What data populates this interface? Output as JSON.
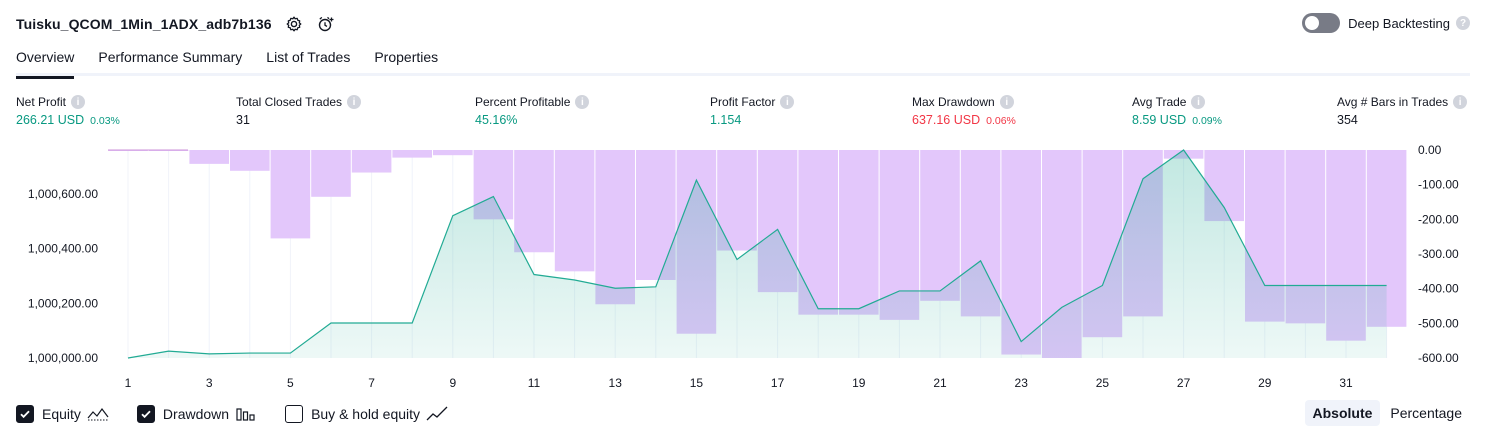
{
  "header": {
    "strategy_name": "Tuisku_QCOM_1Min_1ADX_adb7b136",
    "deep_backtesting_label": "Deep Backtesting",
    "deep_backtesting_on": false
  },
  "tabs": [
    {
      "label": "Overview",
      "active": true
    },
    {
      "label": "Performance Summary",
      "active": false
    },
    {
      "label": "List of Trades",
      "active": false
    },
    {
      "label": "Properties",
      "active": false
    }
  ],
  "stats": [
    {
      "label": "Net Profit",
      "value": "266.21 USD",
      "sub": "0.03%",
      "tone": "pos"
    },
    {
      "label": "Total Closed Trades",
      "value": "31",
      "sub": "",
      "tone": "neutral"
    },
    {
      "label": "Percent Profitable",
      "value": "45.16%",
      "sub": "",
      "tone": "pos"
    },
    {
      "label": "Profit Factor",
      "value": "1.154",
      "sub": "",
      "tone": "pos"
    },
    {
      "label": "Max Drawdown",
      "value": "637.16 USD",
      "sub": "0.06%",
      "tone": "neg"
    },
    {
      "label": "Avg Trade",
      "value": "8.59 USD",
      "sub": "0.09%",
      "tone": "pos"
    },
    {
      "label": "Avg # Bars in Trades",
      "value": "354",
      "sub": "",
      "tone": "neutral"
    }
  ],
  "chart_data": {
    "type": "line",
    "x": [
      1,
      2,
      3,
      4,
      5,
      6,
      7,
      8,
      9,
      10,
      11,
      12,
      13,
      14,
      15,
      16,
      17,
      18,
      19,
      20,
      21,
      22,
      23,
      24,
      25,
      26,
      27,
      28,
      29,
      30,
      31,
      32
    ],
    "x_ticks": [
      1,
      3,
      5,
      7,
      9,
      11,
      13,
      15,
      17,
      19,
      21,
      23,
      25,
      27,
      29,
      31
    ],
    "series": [
      {
        "name": "Equity",
        "axis": "left",
        "style": "area",
        "color": "#22ab94",
        "values": [
          1000000,
          1000025,
          1000015,
          1000018,
          1000018,
          1000128,
          1000128,
          1000128,
          1000520,
          1000590,
          1000305,
          1000285,
          1000255,
          1000260,
          1000650,
          1000360,
          1000470,
          1000180,
          1000180,
          1000245,
          1000245,
          1000355,
          1000060,
          1000185,
          1000265,
          1000655,
          1000760,
          1000550,
          1000265,
          1000265,
          1000265,
          1000265
        ]
      },
      {
        "name": "Drawdown",
        "axis": "right",
        "style": "bar",
        "color": "#ce93d8",
        "values": [
          -2,
          -2,
          -40,
          -60,
          -255,
          -135,
          -65,
          -22,
          -15,
          -200,
          -295,
          -350,
          -445,
          -375,
          -530,
          -290,
          -410,
          -475,
          -475,
          -490,
          -435,
          -480,
          -590,
          -600,
          -540,
          -480,
          -25,
          -205,
          -495,
          -500,
          -550,
          -510
        ]
      }
    ],
    "left_axis": {
      "ticks": [
        1000000,
        1000200,
        1000400,
        1000600
      ],
      "tick_labels": [
        "1,000,000.00",
        "1,000,200.00",
        "1,000,400.00",
        "1,000,600.00"
      ],
      "ylim": [
        1000000,
        1000760
      ]
    },
    "right_axis": {
      "ticks": [
        0,
        -100,
        -200,
        -300,
        -400,
        -500,
        -600
      ],
      "tick_labels": [
        "0.00",
        "-100.00",
        "-200.00",
        "-300.00",
        "-400.00",
        "-500.00",
        "-600.00"
      ],
      "ylim": [
        -600,
        0
      ]
    },
    "grid": true
  },
  "legend": [
    {
      "label": "Equity",
      "checked": true,
      "icon": "area-line-icon"
    },
    {
      "label": "Drawdown",
      "checked": true,
      "icon": "bars-icon"
    },
    {
      "label": "Buy & hold equity",
      "checked": false,
      "icon": "line-icon"
    }
  ],
  "modes": [
    {
      "label": "Absolute",
      "active": true
    },
    {
      "label": "Percentage",
      "active": false
    }
  ]
}
